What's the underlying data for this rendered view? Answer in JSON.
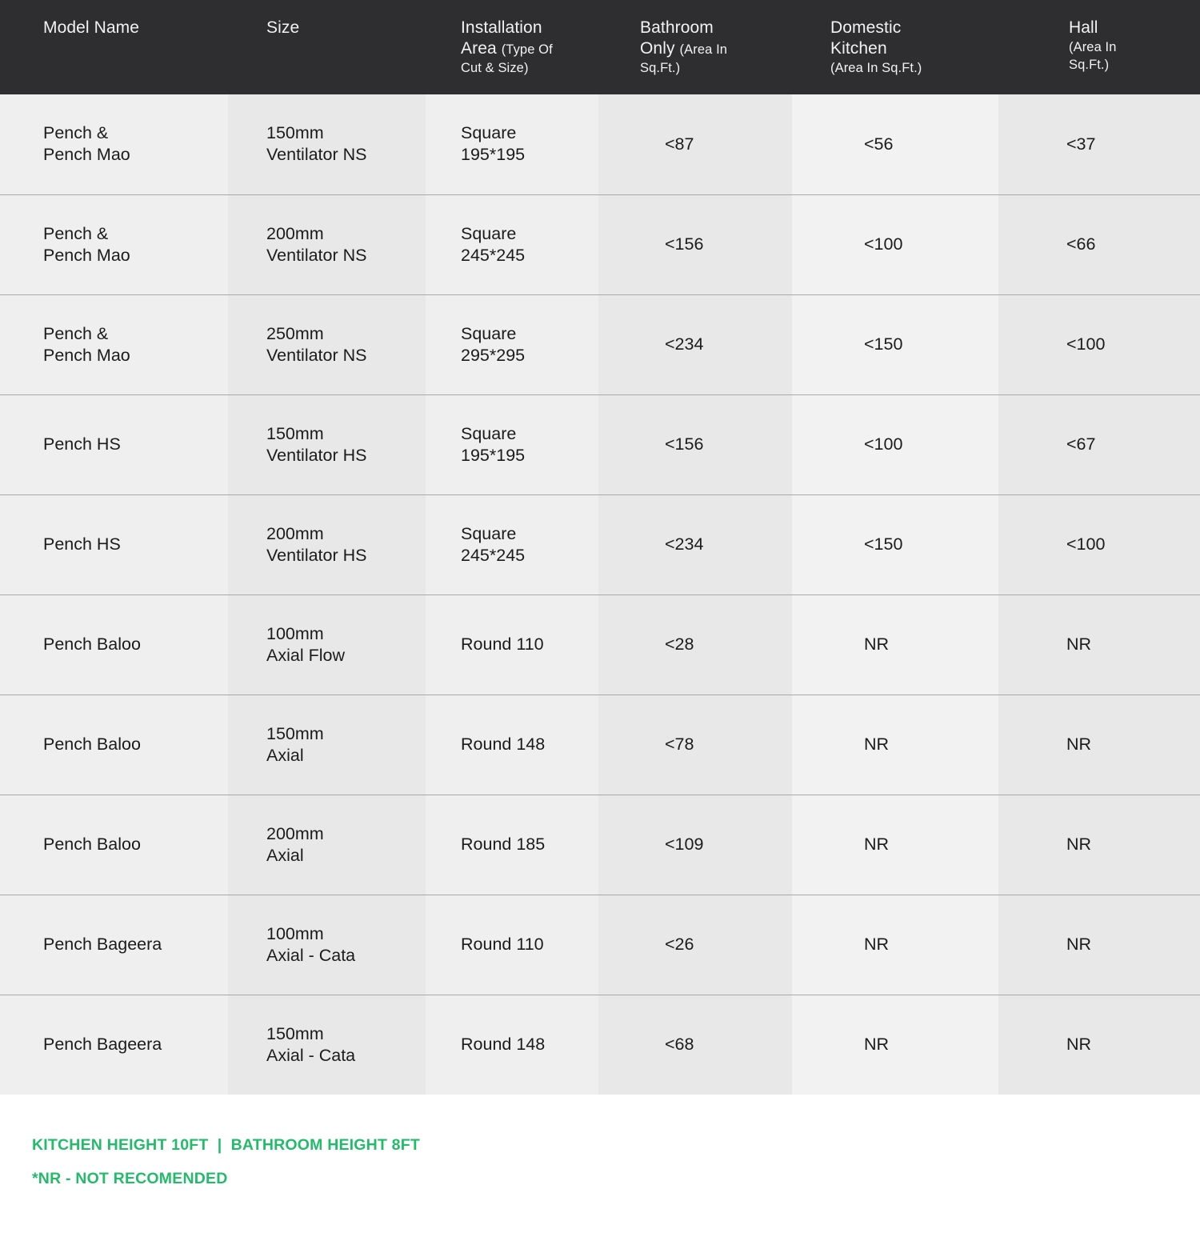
{
  "table": {
    "columns": [
      {
        "key": "model",
        "title": "Model Name",
        "sub": ""
      },
      {
        "key": "size",
        "title": "Size",
        "sub": ""
      },
      {
        "key": "inst",
        "title": "Installation",
        "title2": "Area",
        "sub": "(Type Of",
        "sub2": "Cut & Size)"
      },
      {
        "key": "bath",
        "title": "Bathroom",
        "title2": "Only",
        "sub": "(Area In",
        "sub2": "Sq.Ft.)"
      },
      {
        "key": "kitch",
        "title": "Domestic",
        "title2": "Kitchen",
        "sub": "(Area In Sq.Ft.)",
        "sub2": ""
      },
      {
        "key": "hall",
        "title": "Hall",
        "sub": "(Area In",
        "sub2": "Sq.Ft.)"
      }
    ],
    "rows": [
      {
        "model_l1": "Pench &",
        "model_l2": "Pench Mao",
        "size_l1": "150mm",
        "size_l2": "Ventilator NS",
        "inst_l1": "Square",
        "inst_l2": "195*195",
        "bath": "<87",
        "kitchen": "<56",
        "hall": "<37"
      },
      {
        "model_l1": "Pench &",
        "model_l2": "Pench Mao",
        "size_l1": "200mm",
        "size_l2": "Ventilator NS",
        "inst_l1": "Square",
        "inst_l2": "245*245",
        "bath": "<156",
        "kitchen": "<100",
        "hall": "<66"
      },
      {
        "model_l1": "Pench &",
        "model_l2": "Pench Mao",
        "size_l1": "250mm",
        "size_l2": "Ventilator NS",
        "inst_l1": "Square",
        "inst_l2": "295*295",
        "bath": "<234",
        "kitchen": "<150",
        "hall": "<100"
      },
      {
        "model_l1": "Pench HS",
        "model_l2": "",
        "size_l1": "150mm",
        "size_l2": "Ventilator HS",
        "inst_l1": "Square",
        "inst_l2": "195*195",
        "bath": "<156",
        "kitchen": "<100",
        "hall": "<67"
      },
      {
        "model_l1": "Pench HS",
        "model_l2": "",
        "size_l1": "200mm",
        "size_l2": "Ventilator HS",
        "inst_l1": "Square",
        "inst_l2": "245*245",
        "bath": "<234",
        "kitchen": "<150",
        "hall": "<100"
      },
      {
        "model_l1": "Pench Baloo",
        "model_l2": "",
        "size_l1": "100mm",
        "size_l2": "Axial Flow",
        "inst_l1": "Round 110",
        "inst_l2": "",
        "bath": "<28",
        "kitchen": "NR",
        "hall": "NR"
      },
      {
        "model_l1": "Pench Baloo",
        "model_l2": "",
        "size_l1": "150mm",
        "size_l2": "Axial",
        "inst_l1": "Round 148",
        "inst_l2": "",
        "bath": "<78",
        "kitchen": "NR",
        "hall": "NR"
      },
      {
        "model_l1": "Pench Baloo",
        "model_l2": "",
        "size_l1": "200mm",
        "size_l2": "Axial",
        "inst_l1": "Round 185",
        "inst_l2": "",
        "bath": "<109",
        "kitchen": "NR",
        "hall": "NR"
      },
      {
        "model_l1": "Pench Bageera",
        "model_l2": "",
        "size_l1": "100mm",
        "size_l2": "Axial - Cata",
        "inst_l1": "Round 110",
        "inst_l2": "",
        "bath": "<26",
        "kitchen": "NR",
        "hall": "NR"
      },
      {
        "model_l1": "Pench Bageera",
        "model_l2": "",
        "size_l1": "150mm",
        "size_l2": "Axial - Cata",
        "inst_l1": "Round 148",
        "inst_l2": "",
        "bath": "<68",
        "kitchen": "NR",
        "hall": "NR"
      }
    ]
  },
  "notes": {
    "line1": "KITCHEN HEIGHT 10FT  |  BATHROOM HEIGHT 8FT",
    "line2": "*NR - NOT RECOMENDED",
    "color": "#22bb6a"
  }
}
